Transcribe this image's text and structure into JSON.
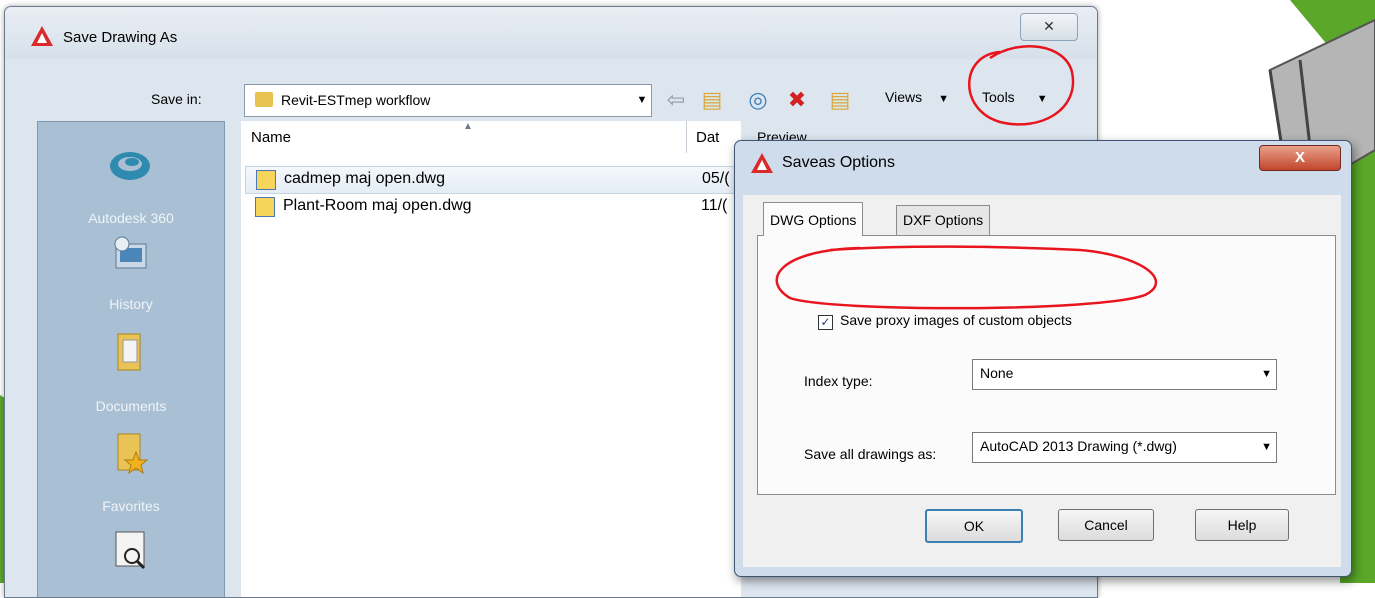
{
  "save_dialog": {
    "title": "Save Drawing As",
    "close_glyph": "✕",
    "save_in_label": "Save in:",
    "save_in_value": "Revit-ESTmep workflow",
    "toolbar": {
      "icons": [
        "back-arrow-icon",
        "up-folder-icon",
        "search-web-icon",
        "delete-icon",
        "new-folder-icon"
      ],
      "views_label": "Views",
      "tools_label": "Tools"
    },
    "places": [
      {
        "label": "Autodesk 360",
        "icon": "autodesk-360-icon"
      },
      {
        "label": "History",
        "icon": "history-icon"
      },
      {
        "label": "Documents",
        "icon": "documents-folder-icon"
      },
      {
        "label": "Favorites",
        "icon": "favorites-folder-icon"
      },
      {
        "label": "",
        "icon": "find-icon"
      }
    ],
    "columns": {
      "name": "Name",
      "date": "Dat"
    },
    "files": [
      {
        "name": "cadmep maj open.dwg",
        "date": "05/(",
        "selected": true
      },
      {
        "name": "Plant-Room maj open.dwg",
        "date": "11/(",
        "selected": false
      }
    ],
    "preview_label": "Preview"
  },
  "saveas_options": {
    "title": "Saveas Options",
    "close_glyph": "X",
    "tabs": [
      "DWG Options",
      "DXF Options"
    ],
    "active_tab": "DWG Options",
    "proxy_checkbox": {
      "label": "Save proxy images of custom objects",
      "checked": true,
      "mark": "✓"
    },
    "index_type_label": "Index type:",
    "index_type_value": "None",
    "save_all_label": "Save all drawings as:",
    "save_all_value": "AutoCAD 2013 Drawing (*.dwg)",
    "buttons": {
      "ok": "OK",
      "cancel": "Cancel",
      "help": "Help"
    }
  },
  "colors": {
    "annotation": "#e8151e",
    "cad_green": "#5aa72a",
    "places_bg": "#a9bfd3"
  }
}
